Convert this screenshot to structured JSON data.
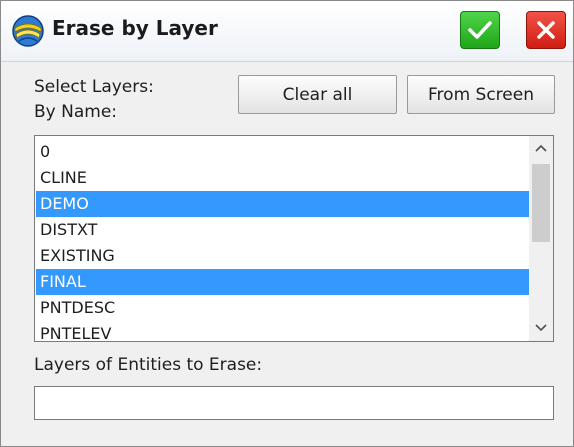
{
  "window": {
    "title": "Erase by Layer",
    "ok_icon": "checkmark-icon",
    "close_icon": "close-x-icon",
    "app_icon": "globe-layers-icon"
  },
  "labels": {
    "select_layers": "Select Layers:",
    "by_name": "By Name:",
    "layers_to_erase": "Layers of Entities to Erase:"
  },
  "buttons": {
    "clear_all": "Clear all",
    "from_screen": "From Screen"
  },
  "layers": [
    {
      "name": "0",
      "selected": false
    },
    {
      "name": "CLINE",
      "selected": false
    },
    {
      "name": "DEMO",
      "selected": true
    },
    {
      "name": "DISTXT",
      "selected": false
    },
    {
      "name": "EXISTING",
      "selected": false
    },
    {
      "name": "FINAL",
      "selected": true
    },
    {
      "name": "PNTDESC",
      "selected": false
    },
    {
      "name": "PNTELEV",
      "selected": false
    }
  ],
  "erase_field": {
    "value": ""
  },
  "colors": {
    "selection": "#3399ff",
    "ok_green": "#2bb826",
    "close_red": "#e2291e"
  }
}
